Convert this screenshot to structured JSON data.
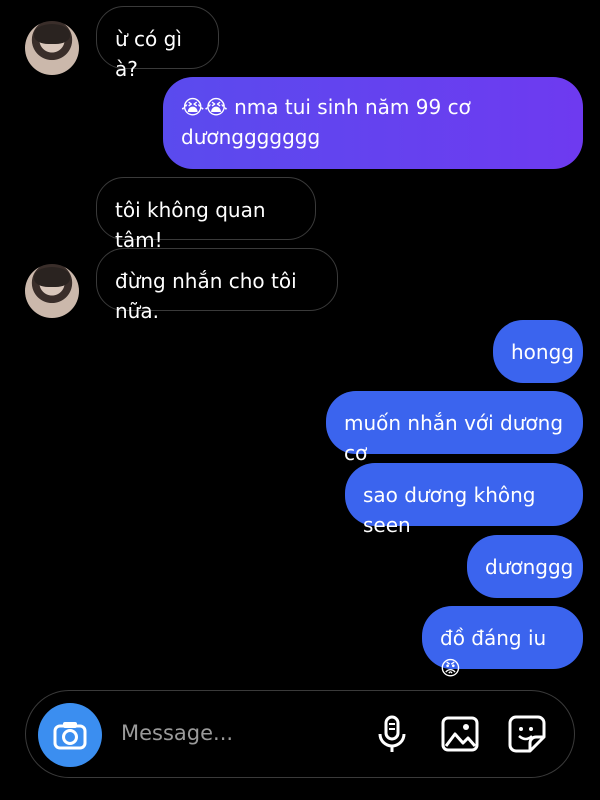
{
  "messages": [
    {
      "side": "in",
      "text": "ừ có gì à?"
    },
    {
      "side": "out",
      "text": "😭😭 nma tui sinh năm 99 cơ\ndươnggggggg"
    },
    {
      "side": "in",
      "text": "tôi không quan tâm!"
    },
    {
      "side": "in",
      "text": "đừng nhắn cho tôi nữa."
    },
    {
      "side": "out",
      "text": "hongg"
    },
    {
      "side": "out",
      "text": "muốn nhắn với dương cơ"
    },
    {
      "side": "out",
      "text": "sao dương không seen"
    },
    {
      "side": "out",
      "text": "dươnggg"
    },
    {
      "side": "out",
      "text": "đồ đáng iu😡"
    }
  ],
  "composer": {
    "placeholder": "Message...",
    "icons": [
      "camera-icon",
      "microphone-icon",
      "image-icon",
      "sticker-icon"
    ]
  },
  "colors": {
    "background": "#000000",
    "outgoing_bubble": "#3b64ee",
    "outgoing_gradient": [
      "#5a4bee",
      "#6e3af0"
    ],
    "incoming_border": "#3a3a3a",
    "camera_button": "#3b8ef0"
  }
}
